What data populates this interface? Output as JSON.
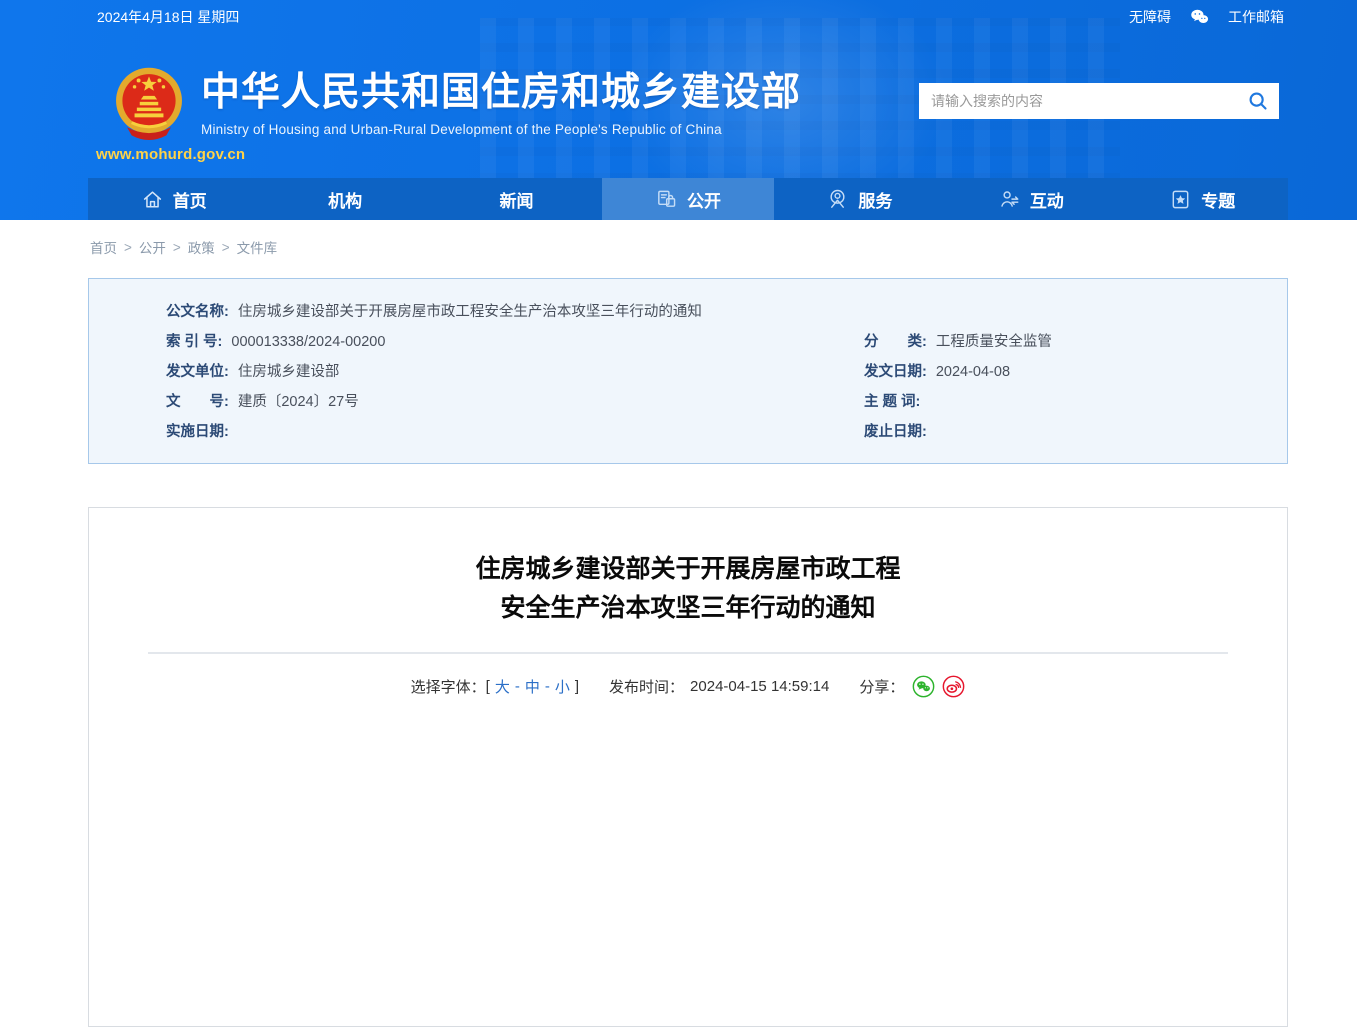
{
  "topbar": {
    "date": "2024年4月18日 星期四",
    "accessibility_label": "无障碍",
    "mailbox_label": "工作邮箱"
  },
  "header": {
    "site_name": "中华人民共和国住房和城乡建设部",
    "site_name_en": "Ministry of Housing and Urban-Rural Development of the People's Republic of China",
    "site_url": "www.mohurd.gov.cn",
    "search_placeholder": "请输入搜索的内容"
  },
  "nav": {
    "items": [
      {
        "label": "首页",
        "icon": "home-icon",
        "active": false
      },
      {
        "label": "机构",
        "icon": "",
        "active": false
      },
      {
        "label": "新闻",
        "icon": "",
        "active": false
      },
      {
        "label": "公开",
        "icon": "open-file-lock-icon",
        "active": true
      },
      {
        "label": "服务",
        "icon": "service-agent-icon",
        "active": false
      },
      {
        "label": "互动",
        "icon": "interaction-person-icon",
        "active": false
      },
      {
        "label": "专题",
        "icon": "star-topic-icon",
        "active": false
      }
    ]
  },
  "breadcrumb": {
    "items": [
      "首页",
      "公开",
      "政策",
      "文件库"
    ],
    "separator": ">"
  },
  "doc_meta": {
    "name_row": {
      "label": "公文名称:",
      "value": "住房城乡建设部关于开展房屋市政工程安全生产治本攻坚三年行动的通知"
    },
    "left_rows": [
      {
        "label": "索 引 号:",
        "value": "000013338/2024-00200"
      },
      {
        "label": "发文单位:",
        "value": "住房城乡建设部"
      },
      {
        "label": "文　　号:",
        "value": "建质〔2024〕27号"
      },
      {
        "label": "实施日期:",
        "value": ""
      }
    ],
    "right_rows": [
      {
        "label": "分　　类:",
        "value": "工程质量安全监管"
      },
      {
        "label": "发文日期:",
        "value": "2024-04-08"
      },
      {
        "label": "主 题 词:",
        "value": ""
      },
      {
        "label": "废止日期:",
        "value": ""
      }
    ]
  },
  "article": {
    "title_line1": "住房城乡建设部关于开展房屋市政工程",
    "title_line2": "安全生产治本攻坚三年行动的通知",
    "toolbar": {
      "font_label": "选择字体：",
      "bracket_open": "[",
      "font_sizes": [
        "大",
        "中",
        "小"
      ],
      "separator": "-",
      "bracket_close": "]",
      "publish_label": "发布时间：",
      "publish_time": "2024-04-15 14:59:14",
      "share_label": "分享："
    }
  },
  "icons": {
    "topbar_chat": "wechat-icon",
    "search": "search-icon",
    "emblem": "china-national-emblem",
    "share": [
      "wechat-share-icon",
      "weibo-share-icon"
    ]
  },
  "colors": {
    "header_blue": "#0c6fe2",
    "nav_blue": "#0d63c4",
    "nav_active_blue": "#3e86d6",
    "meta_box_bg": "#f0f6fc",
    "meta_box_border": "#a6c8ea",
    "link_blue": "#2b6fc7",
    "url_yellow": "#ffd348",
    "wechat_green": "#2cb32c",
    "weibo_red": "#e6162d"
  }
}
